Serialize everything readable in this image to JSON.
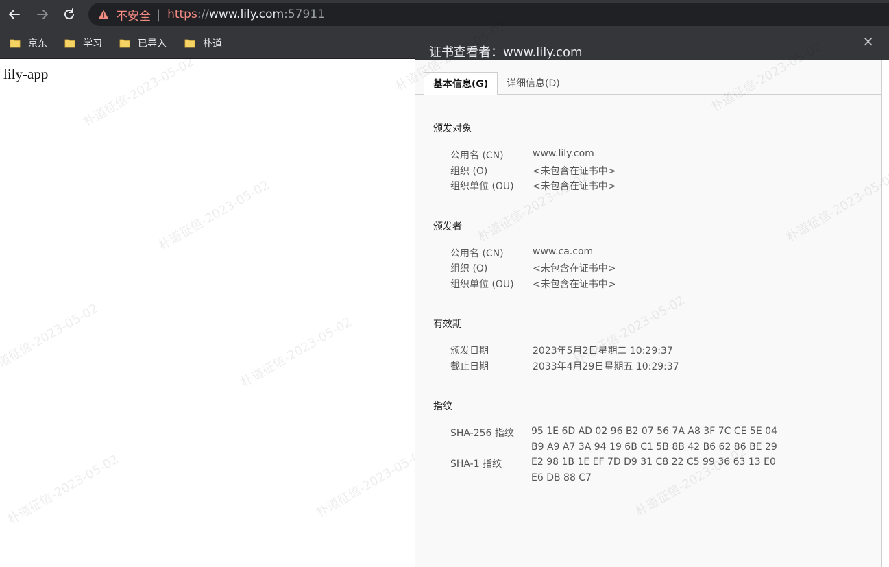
{
  "browser": {
    "security_label": "不安全",
    "url": {
      "scheme": "https",
      "separator": "://",
      "host": "www.lily.com",
      "port": ":57911"
    }
  },
  "bookmarks": [
    {
      "label": "京东"
    },
    {
      "label": "学习"
    },
    {
      "label": "已导入"
    },
    {
      "label": "朴道"
    }
  ],
  "page": {
    "text": "lily-app"
  },
  "watermark": "朴道征信-2023-05-02",
  "cert_viewer": {
    "title": "证书查看者：www.lily.com",
    "close_glyph": "×",
    "tabs": [
      {
        "label": "基本信息(G)"
      },
      {
        "label": "详细信息(D)"
      }
    ],
    "issued_to": {
      "title": "颁发对象",
      "rows": [
        {
          "label": "公用名 (CN)",
          "value": "www.lily.com"
        },
        {
          "label": "组织 (O)",
          "value": "<未包含在证书中>"
        },
        {
          "label": "组织单位 (OU)",
          "value": "<未包含在证书中>"
        }
      ]
    },
    "issued_by": {
      "title": "颁发者",
      "rows": [
        {
          "label": "公用名 (CN)",
          "value": "www.ca.com"
        },
        {
          "label": "组织 (O)",
          "value": "<未包含在证书中>"
        },
        {
          "label": "组织单位 (OU)",
          "value": "<未包含在证书中>"
        }
      ]
    },
    "validity": {
      "title": "有效期",
      "rows": [
        {
          "label": "颁发日期",
          "value": "2023年5月2日星期二 10:29:37"
        },
        {
          "label": "截止日期",
          "value": "2033年4月29日星期五 10:29:37"
        }
      ]
    },
    "fingerprints": {
      "title": "指纹",
      "sha256_label": "SHA-256 指纹",
      "sha256_lines": [
        "95 1E 6D AD 02 96 B2 07 56 7A A8 3F 7C CE 5E 04",
        "B9 A9 A7 3A 94 19 6B C1 5B 8B 42 B6 62 86 BE 29"
      ],
      "sha1_label": "SHA-1 指纹",
      "sha1_lines": [
        "E2 98 1B 1E EF 7D D9 31 C8 22 C5 99 36 63 13 E0",
        "E6 DB 88 C7"
      ]
    }
  }
}
